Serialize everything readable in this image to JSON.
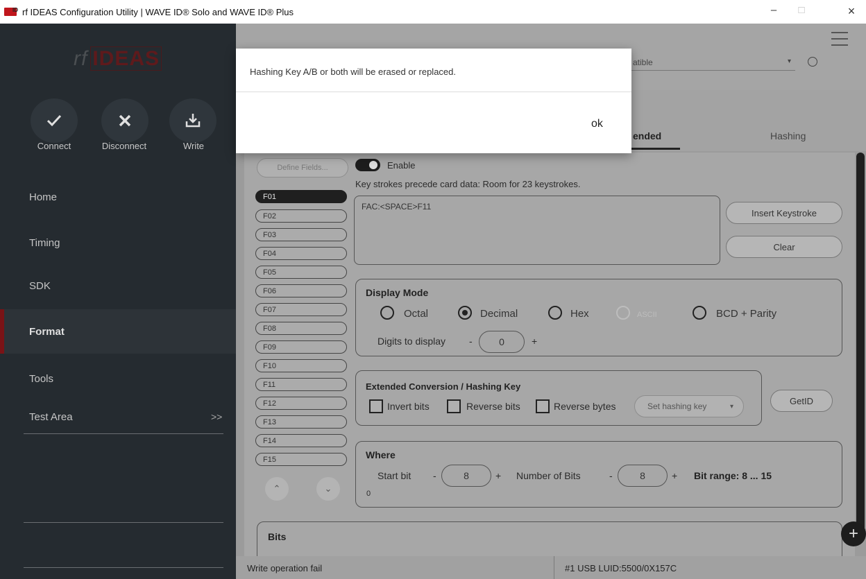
{
  "window": {
    "title": "rf IDEAS Configuration Utility | WAVE ID® Solo and WAVE ID® Plus",
    "minimize": "–",
    "maximize": "□",
    "close": "×"
  },
  "sidebar": {
    "brand_rf": "rf",
    "brand_ideas": "IDEAS",
    "tools": [
      {
        "label": "Connect",
        "icon": "check-icon"
      },
      {
        "label": "Disconnect",
        "icon": "x-icon"
      },
      {
        "label": "Write",
        "icon": "download-icon"
      }
    ],
    "nav": [
      {
        "label": "Home"
      },
      {
        "label": "Timing"
      },
      {
        "label": "SDK"
      },
      {
        "label": "Format",
        "active": true
      },
      {
        "label": "Tools"
      },
      {
        "label": "Test Area",
        "chevron": ">>"
      }
    ]
  },
  "header": {
    "device_select": "atible",
    "select_arrow": "▾"
  },
  "tabs": {
    "extended": "ended",
    "hashing": "Hashing"
  },
  "format": {
    "define_fields": "Define Fields...",
    "fields": [
      "F01",
      "F02",
      "F03",
      "F04",
      "F05",
      "F06",
      "F07",
      "F08",
      "F09",
      "F10",
      "F11",
      "F12",
      "F13",
      "F14",
      "F15"
    ],
    "active_field": "F01",
    "enable_label": "Enable",
    "room_text": "Key strokes precede card data: Room for 23 keystrokes.",
    "keystrokes": "FAC:<SPACE>F11",
    "insert_keystroke": "Insert Keystroke",
    "clear": "Clear",
    "display_mode": {
      "title": "Display Mode",
      "options": [
        "Octal",
        "Decimal",
        "Hex",
        "ASCII",
        "BCD + Parity"
      ],
      "selected": "Decimal",
      "disabled": [
        "ASCII"
      ],
      "digits_label": "Digits to display",
      "digits_value": "0",
      "minus": "-",
      "plus": "+"
    },
    "hashing": {
      "title": "Extended Conversion / Hashing Key",
      "invert_bits": "Invert bits",
      "reverse_bits": "Reverse bits",
      "reverse_bytes": "Reverse bytes",
      "set_hashing_key": "Set hashing key",
      "getid": "GetID"
    },
    "where": {
      "title": "Where",
      "start_bit_label": "Start bit",
      "start_bit_value": "8",
      "num_bits_label": "Number of Bits",
      "num_bits_value": "8",
      "bit_range": "Bit range: 8 ... 15",
      "zero": "0",
      "minus": "-",
      "plus": "+"
    },
    "bits_title": "Bits"
  },
  "status": {
    "left": "Write operation fail",
    "right": "#1 USB LUID:5500/0X157C"
  },
  "dialog": {
    "message": "Hashing Key A/B or both will be erased or replaced.",
    "ok": "ok"
  }
}
